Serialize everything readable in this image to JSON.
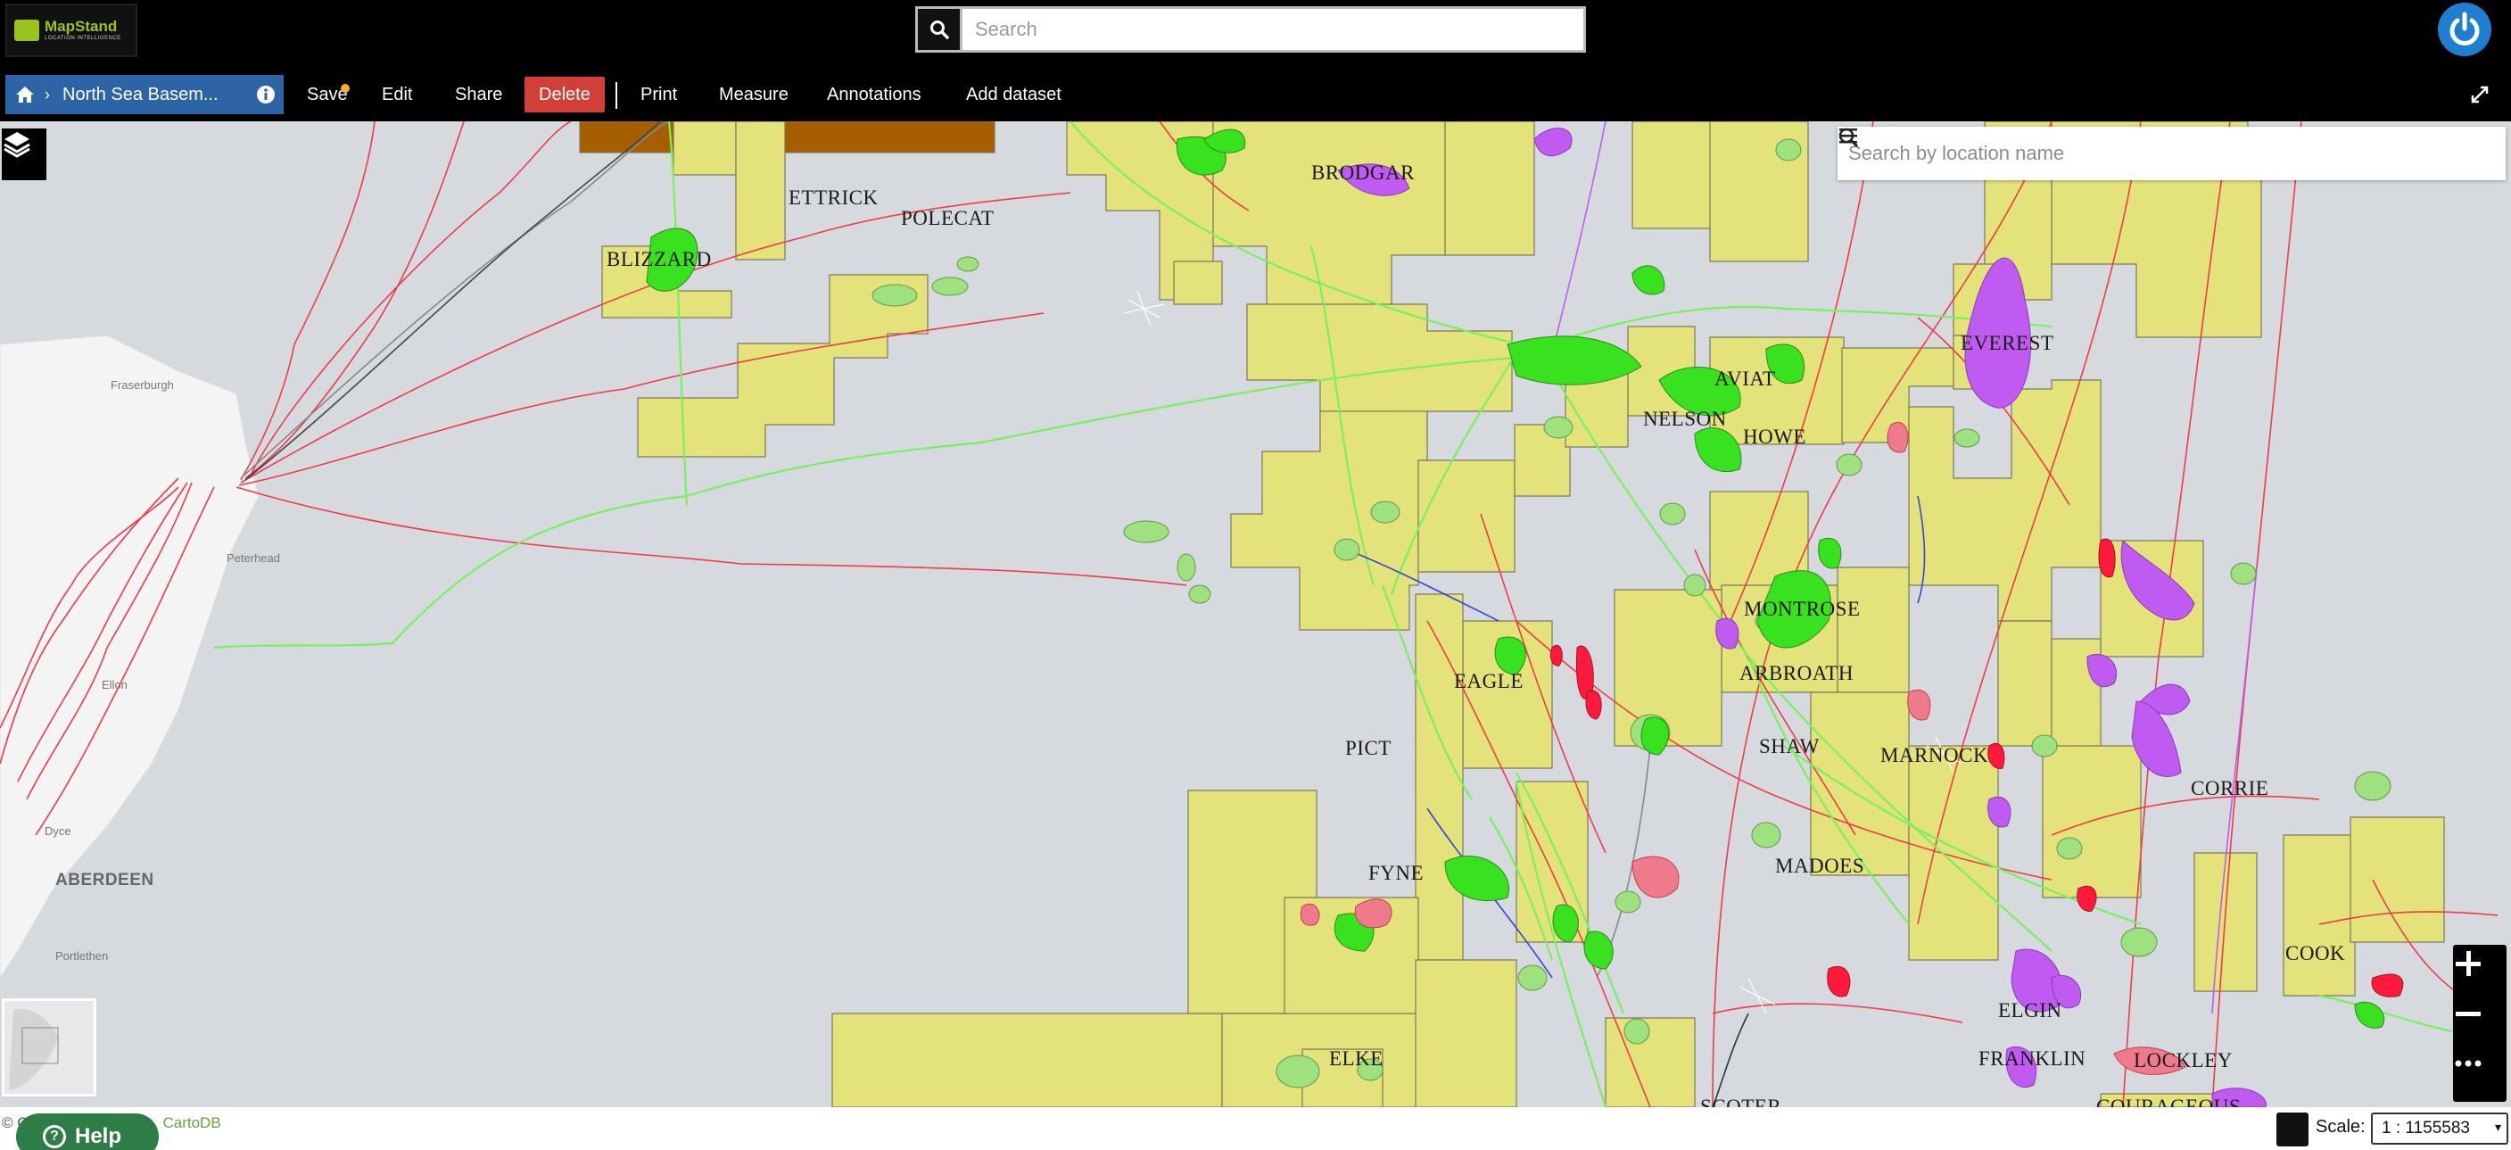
{
  "app": {
    "logo_name": "MapStand",
    "logo_tagline": "LOCATION INTELLIGENCE",
    "search_placeholder": "Search"
  },
  "toolbar": {
    "breadcrumb_title": "North Sea Basem...",
    "save_label": "Save",
    "edit_label": "Edit",
    "share_label": "Share",
    "delete_label": "Delete",
    "print_label": "Print",
    "measure_label": "Measure",
    "annotations_label": "Annotations",
    "add_dataset_label": "Add dataset"
  },
  "map": {
    "location_search_placeholder": "Search by location name",
    "fields": [
      "BRODGAR",
      "ETTRICK",
      "POLECAT",
      "BLIZZARD",
      "EVEREST",
      "AVIAT",
      "NELSON",
      "HOWE",
      "MONTROSE",
      "ARBROATH",
      "EAGLE",
      "PICT",
      "SHAW",
      "MARNOCK",
      "CORRIE",
      "FYNE",
      "MADOES",
      "ELGIN",
      "FRANKLIN",
      "ELKE",
      "COOK",
      "SCOTER",
      "COURAGEOUS",
      "LOCKLEY"
    ],
    "towns": [
      "Fraserburgh",
      "Peterhead",
      "Ellon",
      "Dyce",
      "Portlethen"
    ],
    "cities": [
      "ABERDEEN"
    ],
    "colors": {
      "licence_block": "#e4e27a",
      "oil_field": "#39e21e",
      "gas_field": "#c05bf2",
      "condensate_field": "#ff1a3d",
      "discovery": "#9fe07f",
      "pipeline_red": "#f03a4a",
      "pipeline_green": "#7af060",
      "land": "#f4f4f4",
      "sea": "#d6dade"
    }
  },
  "footer": {
    "attribution": "© O",
    "attribution_link": "CartoDB",
    "help_label": "Help",
    "scale_label": "Scale:",
    "scale_value": "1 : 1155583"
  }
}
